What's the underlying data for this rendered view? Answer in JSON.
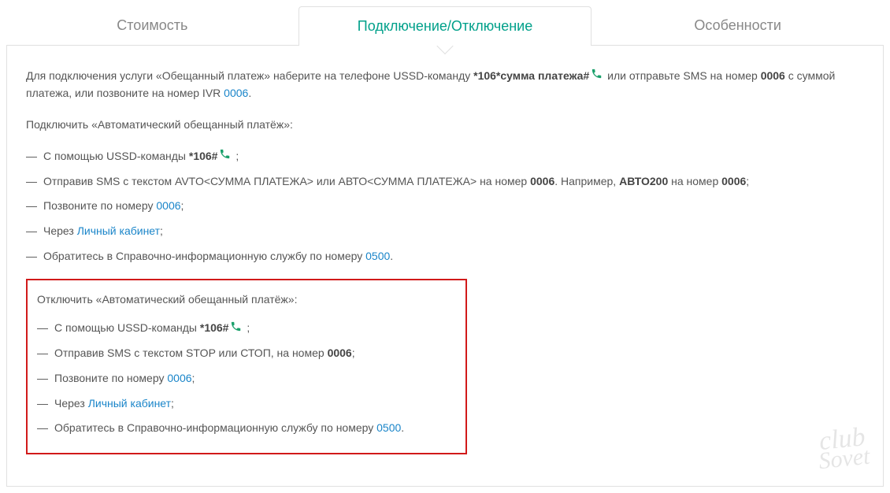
{
  "tabs": {
    "cost": "Стоимость",
    "connection": "Подключение/Отключение",
    "features": "Особенности"
  },
  "intro": {
    "t1": "Для подключения услуги «Обещанный платеж» наберите на телефоне USSD-команду ",
    "ussd": " *106*сумма платежа#",
    "t2": " или отправьте SMS на номер ",
    "sms_num": "0006",
    "t3": " с суммой платежа, или позвоните на номер IVR ",
    "ivr": "0006",
    "t4": "."
  },
  "connect_header": "Подключить «Автоматический обещанный платёж»:",
  "connect": {
    "i1a": "С помощью USSD-команды ",
    "i1b": " *106#",
    "i1c": " ;",
    "i2a": "Отправив SMS с текстом AVTO<СУММА ПЛАТЕЖА> или АВТО<СУММА ПЛАТЕЖА> на номер ",
    "i2b": "0006",
    "i2c": ". Например, ",
    "i2d": "АВТО200",
    "i2e": " на номер ",
    "i2f": "0006",
    "i2g": ";",
    "i3a": "Позвоните по номеру ",
    "i3b": "0006",
    "i3c": ";",
    "i4a": "Через ",
    "i4b": "Личный кабинет",
    "i4c": ";",
    "i5a": "Обратитесь в Справочно-информационную службу по номеру ",
    "i5b": "0500",
    "i5c": "."
  },
  "disconnect_header": "Отключить «Автоматический обещанный платёж»:",
  "disconnect": {
    "d1a": "С помощью USSD-команды ",
    "d1b": " *106#",
    "d1c": " ;",
    "d2a": "Отправив SMS с текстом STOP или СТОП, на номер ",
    "d2b": "0006",
    "d2c": ";",
    "d3a": "Позвоните по номеру ",
    "d3b": "0006",
    "d3c": ";",
    "d4a": "Через ",
    "d4b": "Личный кабинет",
    "d4c": ";",
    "d5a": "Обратитесь в Справочно-информационную службу по номеру ",
    "d5b": "0500",
    "d5c": "."
  },
  "watermark": {
    "l1": "club",
    "l2": "Sovet"
  }
}
